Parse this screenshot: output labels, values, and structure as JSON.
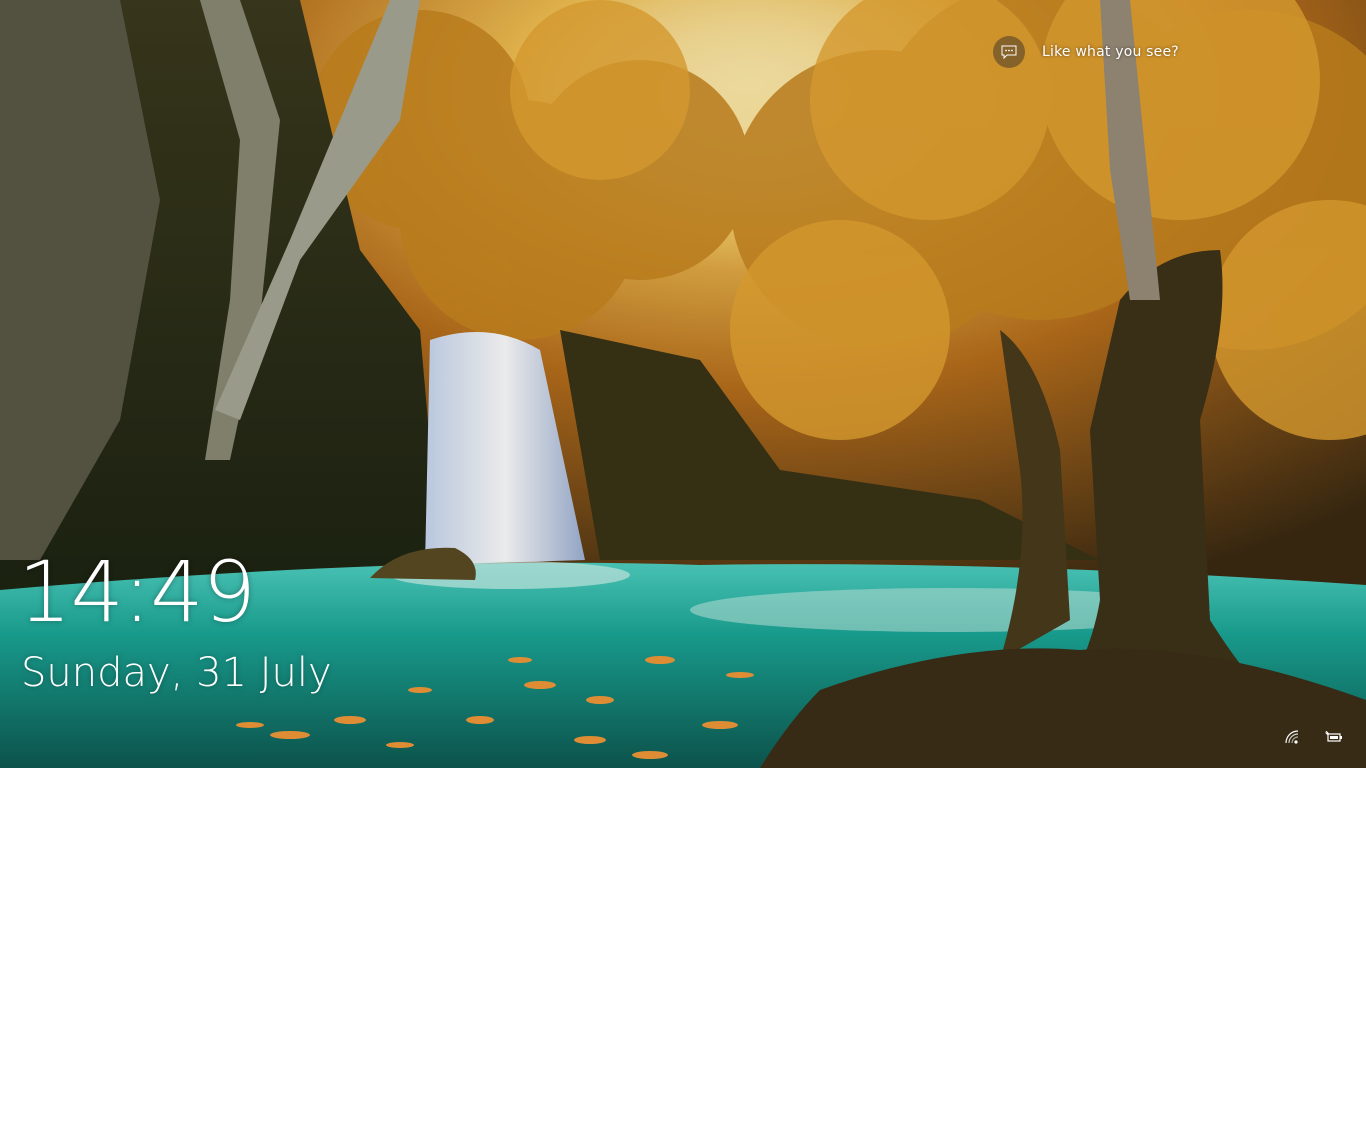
{
  "lockscreen": {
    "spotlight": {
      "icon": "feedback-icon",
      "label": "Like what you see?"
    },
    "time": "14:49",
    "date": "Sunday, 31 July",
    "status_icons": [
      "network-icon",
      "battery-charging-icon"
    ]
  },
  "colors": {
    "text": "#ffffff",
    "water": "#1fa79a",
    "foliage": "#d9902a",
    "below_screen": "#ffffff"
  }
}
